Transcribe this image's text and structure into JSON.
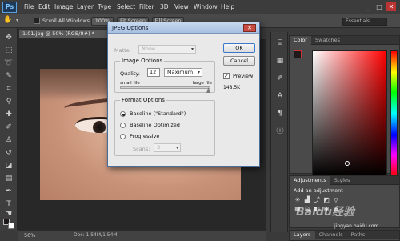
{
  "app": {
    "logo": "Ps"
  },
  "menu": [
    "File",
    "Edit",
    "Image",
    "Layer",
    "Type",
    "Select",
    "Filter",
    "3D",
    "View",
    "Window",
    "Help"
  ],
  "window_controls": {
    "minimize": "_",
    "maximize": "□",
    "close": "✕"
  },
  "options_bar": {
    "hand_icon": "hand-icon",
    "scroll_all": "Scroll All Windows",
    "zoom": "100%",
    "fit_screen": "Fit Screen",
    "fill_screen": "Fill Screen",
    "workspace": "Essentials"
  },
  "document": {
    "tab": "1.01.jpg @ 50% (RGB/8#) *",
    "zoom": "50%",
    "doc_info": "Doc: 1.54M/1.54M"
  },
  "panels": {
    "color_tabs": [
      "Color",
      "Swatches"
    ],
    "adjustments_tabs": [
      "Adjustments",
      "Styles"
    ],
    "adjustments_title": "Add an adjustment",
    "layers_tabs": [
      "Layers",
      "Channels",
      "Paths"
    ]
  },
  "dialog": {
    "title": "JPEG Options",
    "close": "✕",
    "matte_label": "Matte:",
    "matte_value": "None",
    "image_options_title": "Image Options",
    "quality_label": "Quality:",
    "quality_value": "12",
    "quality_preset": "Maximum",
    "small_file": "small file",
    "large_file": "large file",
    "quality_level": 1.0,
    "format_options_title": "Format Options",
    "formats": [
      {
        "label": "Baseline (\"Standard\")",
        "checked": true
      },
      {
        "label": "Baseline Optimized",
        "checked": false
      },
      {
        "label": "Progressive",
        "checked": false
      }
    ],
    "scans_label": "Scans:",
    "scans_value": "3",
    "ok": "OK",
    "cancel": "Cancel",
    "preview_label": "Preview",
    "preview_checked": true,
    "file_size": "148.5K"
  },
  "watermark": {
    "text": "Baidu经验",
    "sub": "jingyan.baidu.com"
  }
}
